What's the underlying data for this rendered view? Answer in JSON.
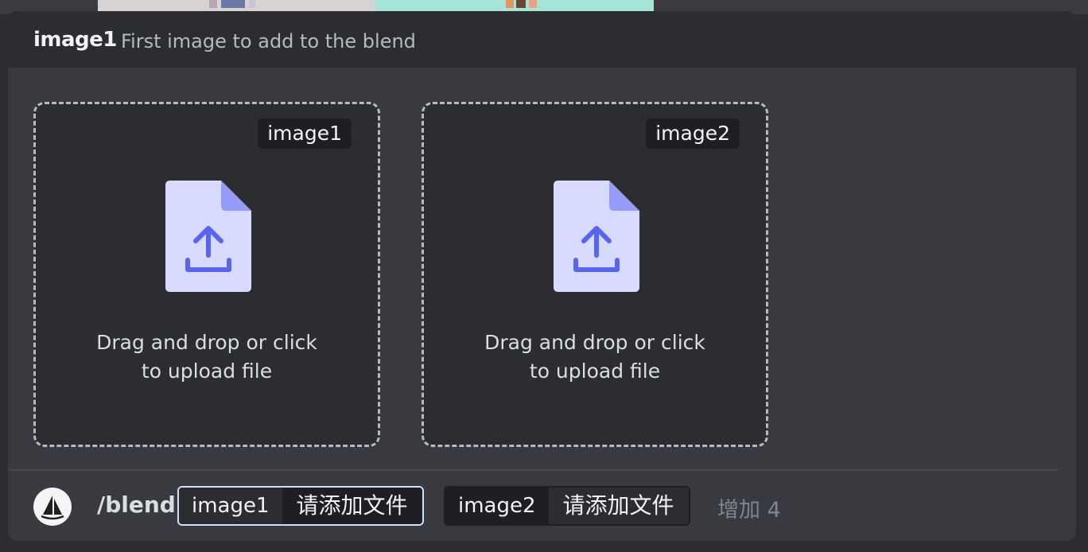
{
  "header": {
    "option_name": "image1",
    "option_description": "First image to add to the blend"
  },
  "dropzones": [
    {
      "badge": "image1",
      "text": "Drag and drop or click to upload file"
    },
    {
      "badge": "image2",
      "text": "Drag and drop or click to upload file"
    }
  ],
  "command_bar": {
    "command": "/blend",
    "options": [
      {
        "name": "image1",
        "value": "请添加文件",
        "state": "active"
      },
      {
        "name": "image2",
        "value": "请添加文件",
        "state": "inactive"
      }
    ],
    "more_label": "增加 4"
  },
  "colors": {
    "accent": "#5865f2",
    "file_icon": "#d9daff",
    "file_fold": "#949cf7",
    "panel": "#383a40"
  },
  "icons": [
    "upload-file-icon",
    "sailboat-icon"
  ]
}
